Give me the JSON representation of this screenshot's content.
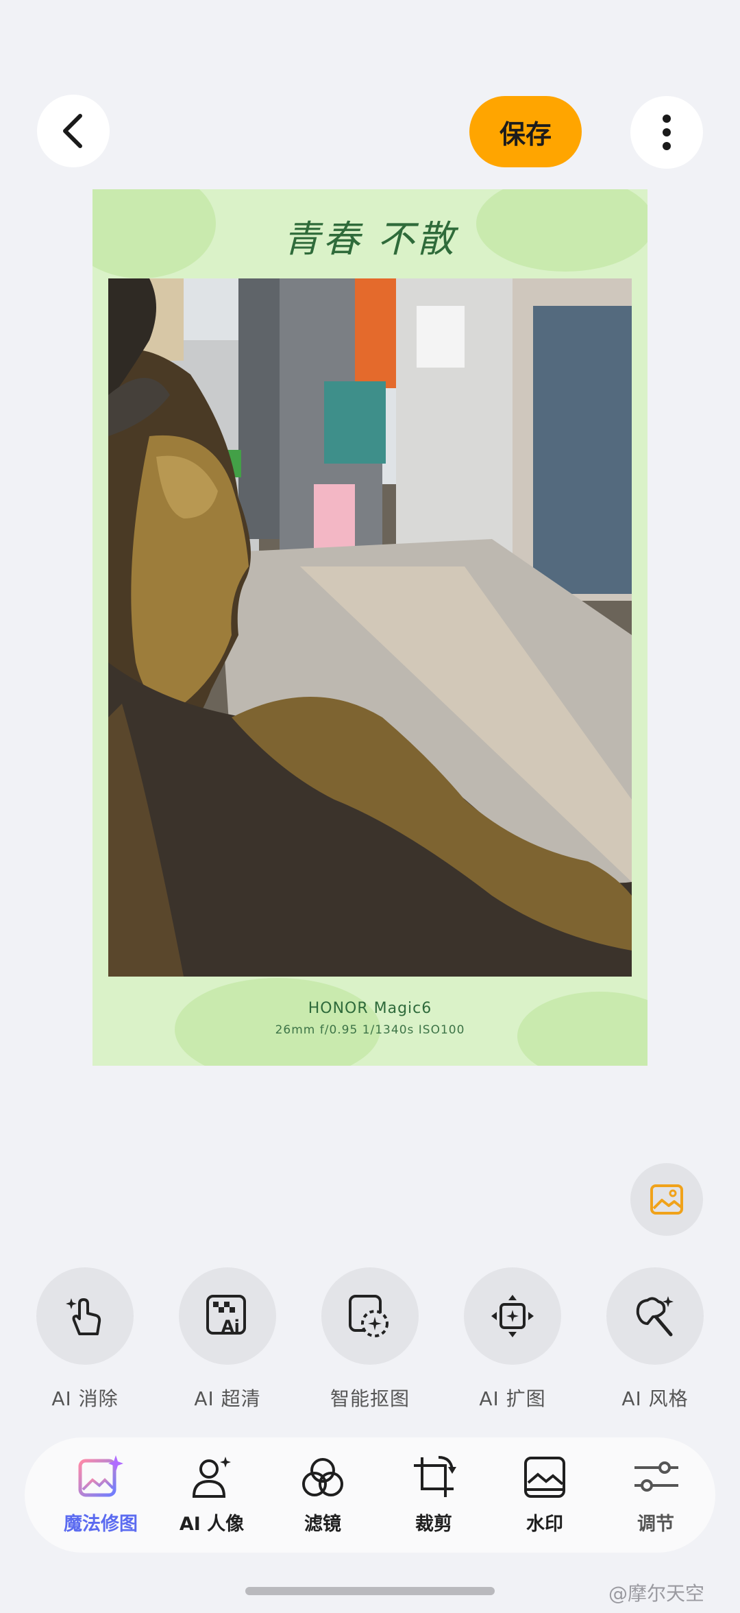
{
  "toolbar": {
    "save_label": "保存"
  },
  "frame": {
    "title": "青春 不散",
    "camera": "HONOR Magic6",
    "params": "26mm  f/0.95  1/1340s  ISO100"
  },
  "ai_tools": [
    {
      "label": "AI 消除",
      "icon": "touch-sparkle-icon"
    },
    {
      "label": "AI 超清",
      "icon": "ai-enhance-icon"
    },
    {
      "label": "智能抠图",
      "icon": "cutout-icon"
    },
    {
      "label": "AI 扩图",
      "icon": "expand-icon"
    },
    {
      "label": "AI 风格",
      "icon": "style-wand-icon"
    }
  ],
  "tabs": [
    {
      "label": "魔法修图",
      "active": true
    },
    {
      "label": "AI 人像",
      "active": false
    },
    {
      "label": "滤镜",
      "active": false
    },
    {
      "label": "裁剪",
      "active": false
    },
    {
      "label": "水印",
      "active": false
    },
    {
      "label": "调节",
      "active": false
    }
  ],
  "watermark": "@摩尔天空",
  "colors": {
    "accent": "#ffa500",
    "active_tab": "#5b6bf0",
    "frame_bg": "#daf2c8"
  }
}
